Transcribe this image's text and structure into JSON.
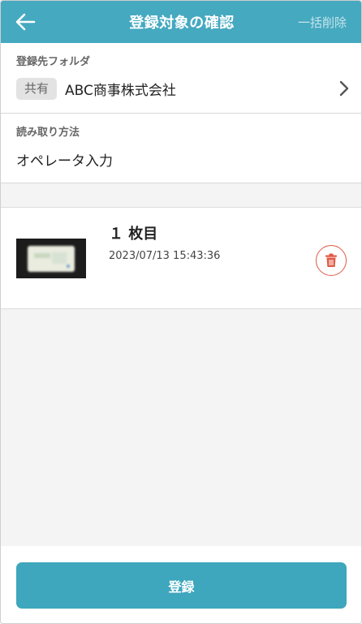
{
  "header": {
    "title": "登録対象の確認",
    "action_label": "一括削除",
    "back_icon": "arrow-left-icon"
  },
  "folder": {
    "label": "登録先フォルダ",
    "badge": "共有",
    "name": "ABC商事株式会社",
    "chevron_icon": "chevron-right-icon"
  },
  "method": {
    "label": "読み取り方法",
    "value": "オペレータ入力"
  },
  "items": [
    {
      "title": "１ 枚目",
      "timestamp": "2023/07/13 15:43:36",
      "delete_icon": "trash-icon"
    }
  ],
  "footer": {
    "register_label": "登録"
  },
  "colors": {
    "header": "#45a9c0",
    "primary_button": "#3ea6bd",
    "delete_accent": "#e05a44",
    "background": "#f4f4f4"
  }
}
